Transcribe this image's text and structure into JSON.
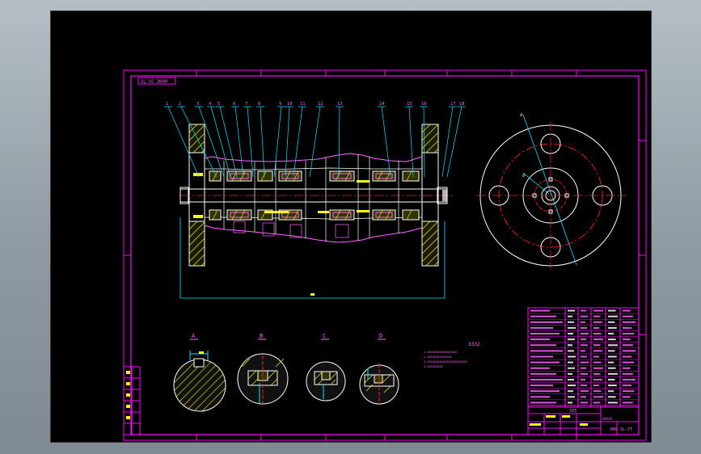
{
  "colors": {
    "background": "#000000",
    "frame": "#ff00ff",
    "outline": "#ffffff",
    "centerline": "#ff2020",
    "leader": "#00e5ff",
    "hatch": "#ffff00",
    "bearing": "#ff66ff"
  },
  "drawing": {
    "title_tag": "SL-SC-3000",
    "annotation_main": "3332",
    "annotation_small": "333",
    "sheet_code": "BWS-SL-YT",
    "notes": [
      "1.XXXXXXXXXXXXXXXXX",
      "2.XXXXXXXXXXXXXX",
      "3.XXXXXXXXXXXXXXXXXXXXXXX",
      "4.XXXXXXXXX"
    ],
    "part_numbers": [
      "1",
      "2",
      "3",
      "4",
      "5",
      "6",
      "7",
      "8",
      "9",
      "10",
      "11",
      "12",
      "13",
      "14",
      "15",
      "16",
      "17",
      "18"
    ]
  },
  "section_labels": [
    "A",
    "B",
    "C",
    "D"
  ]
}
